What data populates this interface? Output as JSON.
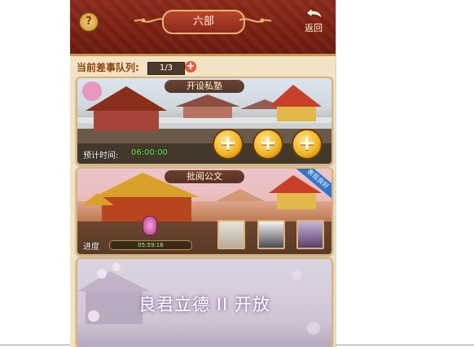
{
  "header": {
    "title": "六部",
    "help_icon_glyph": "?",
    "back_label": "返回"
  },
  "queue": {
    "label": "当前差事队列:",
    "count": "1/3",
    "add_glyph": "+"
  },
  "cards": [
    {
      "title": "开设私塾",
      "plus_glyph": "+",
      "timer_label": "预计时间:",
      "timer_value": "06:00:00"
    },
    {
      "title": "批阅公文",
      "badge": "表现良好",
      "progress_label": "进度",
      "progress_value": "05:59:16",
      "progress_fraction": 0.01
    },
    {
      "title": "良君立德 II 开放"
    }
  ],
  "colors": {
    "header": "#7a2012",
    "gold": "#f2b729",
    "timer_green": "#6cff4a",
    "badge_blue": "#2f76c6"
  }
}
